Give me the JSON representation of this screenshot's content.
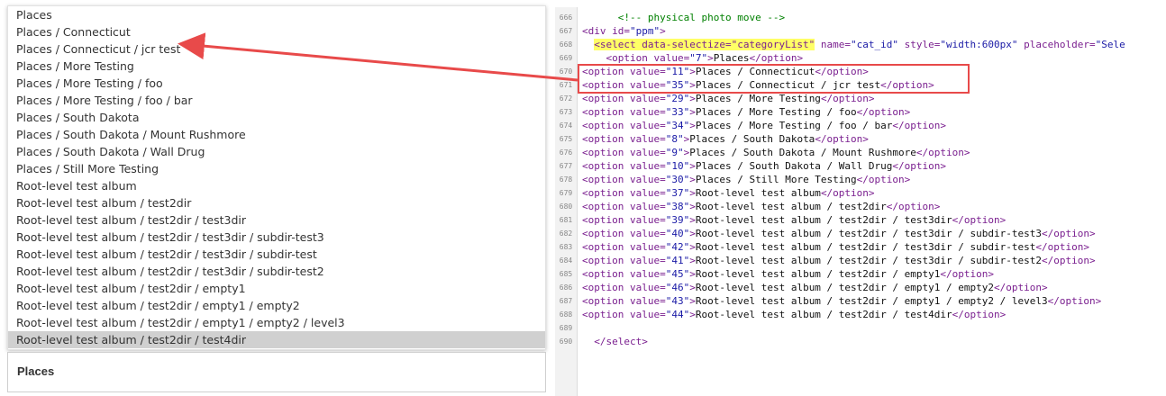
{
  "dropdown": {
    "items": [
      "Places",
      "Places / Connecticut",
      "Places / Connecticut / jcr test",
      "Places / More Testing",
      "Places / More Testing / foo",
      "Places / More Testing / foo / bar",
      "Places / South Dakota",
      "Places / South Dakota / Mount Rushmore",
      "Places / South Dakota / Wall Drug",
      "Places / Still More Testing",
      "Root-level test album",
      "Root-level test album / test2dir",
      "Root-level test album / test2dir / test3dir",
      "Root-level test album / test2dir / test3dir / subdir-test3",
      "Root-level test album / test2dir / test3dir / subdir-test",
      "Root-level test album / test2dir / test3dir / subdir-test2",
      "Root-level test album / test2dir / empty1",
      "Root-level test album / test2dir / empty1 / empty2",
      "Root-level test album / test2dir / empty1 / empty2 / level3",
      "Root-level test album / test2dir / test4dir"
    ],
    "active_index": 19
  },
  "selected": {
    "value": "Places"
  },
  "code": {
    "lines": [
      {
        "n": "666",
        "parts": [
          [
            "      ",
            "txt"
          ],
          [
            "<!-- physical photo move -->",
            "cm"
          ]
        ]
      },
      {
        "n": "667",
        "parts": [
          [
            "<div ",
            "tag"
          ],
          [
            "id=",
            "attr"
          ],
          [
            "\"ppm\"",
            "val"
          ],
          [
            ">",
            "tag"
          ]
        ]
      },
      {
        "n": "668",
        "parts": [
          [
            "  ",
            "txt"
          ],
          [
            "<select data-selectize=\"categoryList\"",
            "tag hl"
          ],
          [
            " name=",
            "attr"
          ],
          [
            "\"cat_id\"",
            "val"
          ],
          [
            " style=",
            "attr"
          ],
          [
            "\"width:600px\"",
            "val"
          ],
          [
            " placeholder=",
            "attr"
          ],
          [
            "\"Sele",
            "val"
          ]
        ]
      },
      {
        "n": "669",
        "parts": [
          [
            "    ",
            "txt"
          ],
          [
            "<option ",
            "tag"
          ],
          [
            "value=",
            "attr"
          ],
          [
            "\"7\"",
            "val"
          ],
          [
            ">",
            "tag"
          ],
          [
            "Places",
            "txt"
          ],
          [
            "</option>",
            "tag"
          ]
        ]
      },
      {
        "n": "670",
        "parts": [
          [
            "<option ",
            "tag"
          ],
          [
            "value=",
            "attr"
          ],
          [
            "\"11\"",
            "val"
          ],
          [
            ">",
            "tag"
          ],
          [
            "Places / Connecticut",
            "txt"
          ],
          [
            "</option>",
            "tag"
          ]
        ]
      },
      {
        "n": "671",
        "parts": [
          [
            "<option ",
            "tag"
          ],
          [
            "value=",
            "attr"
          ],
          [
            "\"35\"",
            "val"
          ],
          [
            ">",
            "tag"
          ],
          [
            "Places / Connecticut / jcr test",
            "txt"
          ],
          [
            "</option>",
            "tag"
          ]
        ]
      },
      {
        "n": "672",
        "parts": [
          [
            "<option ",
            "tag"
          ],
          [
            "value=",
            "attr"
          ],
          [
            "\"29\"",
            "val"
          ],
          [
            ">",
            "tag"
          ],
          [
            "Places / More Testing",
            "txt"
          ],
          [
            "</option>",
            "tag"
          ]
        ]
      },
      {
        "n": "673",
        "parts": [
          [
            "<option ",
            "tag"
          ],
          [
            "value=",
            "attr"
          ],
          [
            "\"33\"",
            "val"
          ],
          [
            ">",
            "tag"
          ],
          [
            "Places / More Testing / foo",
            "txt"
          ],
          [
            "</option>",
            "tag"
          ]
        ]
      },
      {
        "n": "674",
        "parts": [
          [
            "<option ",
            "tag"
          ],
          [
            "value=",
            "attr"
          ],
          [
            "\"34\"",
            "val"
          ],
          [
            ">",
            "tag"
          ],
          [
            "Places / More Testing / foo / bar",
            "txt"
          ],
          [
            "</option>",
            "tag"
          ]
        ]
      },
      {
        "n": "675",
        "parts": [
          [
            "<option ",
            "tag"
          ],
          [
            "value=",
            "attr"
          ],
          [
            "\"8\"",
            "val"
          ],
          [
            ">",
            "tag"
          ],
          [
            "Places / South Dakota",
            "txt"
          ],
          [
            "</option>",
            "tag"
          ]
        ]
      },
      {
        "n": "676",
        "parts": [
          [
            "<option ",
            "tag"
          ],
          [
            "value=",
            "attr"
          ],
          [
            "\"9\"",
            "val"
          ],
          [
            ">",
            "tag"
          ],
          [
            "Places / South Dakota / Mount Rushmore",
            "txt"
          ],
          [
            "</option>",
            "tag"
          ]
        ]
      },
      {
        "n": "677",
        "parts": [
          [
            "<option ",
            "tag"
          ],
          [
            "value=",
            "attr"
          ],
          [
            "\"10\"",
            "val"
          ],
          [
            ">",
            "tag"
          ],
          [
            "Places / South Dakota / Wall Drug",
            "txt"
          ],
          [
            "</option>",
            "tag"
          ]
        ]
      },
      {
        "n": "678",
        "parts": [
          [
            "<option ",
            "tag"
          ],
          [
            "value=",
            "attr"
          ],
          [
            "\"30\"",
            "val"
          ],
          [
            ">",
            "tag"
          ],
          [
            "Places / Still More Testing",
            "txt"
          ],
          [
            "</option>",
            "tag"
          ]
        ]
      },
      {
        "n": "679",
        "parts": [
          [
            "<option ",
            "tag"
          ],
          [
            "value=",
            "attr"
          ],
          [
            "\"37\"",
            "val"
          ],
          [
            ">",
            "tag"
          ],
          [
            "Root-level test album",
            "txt"
          ],
          [
            "</option>",
            "tag"
          ]
        ]
      },
      {
        "n": "680",
        "parts": [
          [
            "<option ",
            "tag"
          ],
          [
            "value=",
            "attr"
          ],
          [
            "\"38\"",
            "val"
          ],
          [
            ">",
            "tag"
          ],
          [
            "Root-level test album / test2dir",
            "txt"
          ],
          [
            "</option>",
            "tag"
          ]
        ]
      },
      {
        "n": "681",
        "parts": [
          [
            "<option ",
            "tag"
          ],
          [
            "value=",
            "attr"
          ],
          [
            "\"39\"",
            "val"
          ],
          [
            ">",
            "tag"
          ],
          [
            "Root-level test album / test2dir / test3dir",
            "txt"
          ],
          [
            "</option>",
            "tag"
          ]
        ]
      },
      {
        "n": "682",
        "parts": [
          [
            "<option ",
            "tag"
          ],
          [
            "value=",
            "attr"
          ],
          [
            "\"40\"",
            "val"
          ],
          [
            ">",
            "tag"
          ],
          [
            "Root-level test album / test2dir / test3dir / subdir-test3",
            "txt"
          ],
          [
            "</option>",
            "tag"
          ]
        ]
      },
      {
        "n": "683",
        "parts": [
          [
            "<option ",
            "tag"
          ],
          [
            "value=",
            "attr"
          ],
          [
            "\"42\"",
            "val"
          ],
          [
            ">",
            "tag"
          ],
          [
            "Root-level test album / test2dir / test3dir / subdir-test",
            "txt"
          ],
          [
            "</option>",
            "tag"
          ]
        ]
      },
      {
        "n": "684",
        "parts": [
          [
            "<option ",
            "tag"
          ],
          [
            "value=",
            "attr"
          ],
          [
            "\"41\"",
            "val"
          ],
          [
            ">",
            "tag"
          ],
          [
            "Root-level test album / test2dir / test3dir / subdir-test2",
            "txt"
          ],
          [
            "</option>",
            "tag"
          ]
        ]
      },
      {
        "n": "685",
        "parts": [
          [
            "<option ",
            "tag"
          ],
          [
            "value=",
            "attr"
          ],
          [
            "\"45\"",
            "val"
          ],
          [
            ">",
            "tag"
          ],
          [
            "Root-level test album / test2dir / empty1",
            "txt"
          ],
          [
            "</option>",
            "tag"
          ]
        ]
      },
      {
        "n": "686",
        "parts": [
          [
            "<option ",
            "tag"
          ],
          [
            "value=",
            "attr"
          ],
          [
            "\"46\"",
            "val"
          ],
          [
            ">",
            "tag"
          ],
          [
            "Root-level test album / test2dir / empty1 / empty2",
            "txt"
          ],
          [
            "</option>",
            "tag"
          ]
        ]
      },
      {
        "n": "687",
        "parts": [
          [
            "<option ",
            "tag"
          ],
          [
            "value=",
            "attr"
          ],
          [
            "\"43\"",
            "val"
          ],
          [
            ">",
            "tag"
          ],
          [
            "Root-level test album / test2dir / empty1 / empty2 / level3",
            "txt"
          ],
          [
            "</option>",
            "tag"
          ]
        ]
      },
      {
        "n": "688",
        "parts": [
          [
            "<option ",
            "tag"
          ],
          [
            "value=",
            "attr"
          ],
          [
            "\"44\"",
            "val"
          ],
          [
            ">",
            "tag"
          ],
          [
            "Root-level test album / test2dir / test4dir",
            "txt"
          ],
          [
            "</option>",
            "tag"
          ]
        ]
      },
      {
        "n": "689",
        "parts": []
      },
      {
        "n": "690",
        "parts": [
          [
            "  ",
            "txt"
          ],
          [
            "</select>",
            "tag"
          ]
        ]
      }
    ]
  },
  "annotation": {
    "color": "#e84a4a"
  }
}
